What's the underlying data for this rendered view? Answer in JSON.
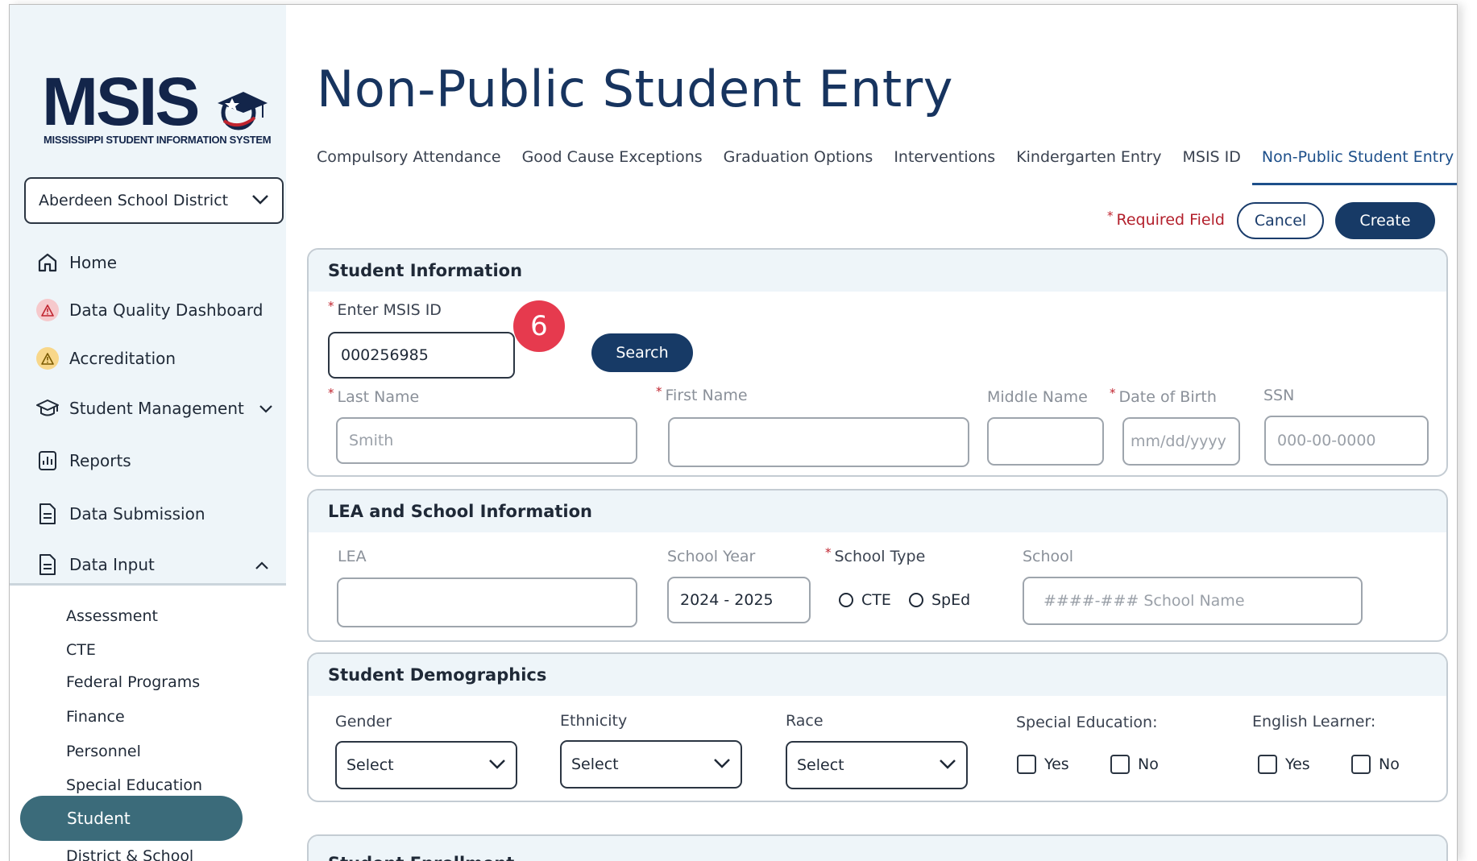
{
  "app": {
    "logo_text": "MSIS",
    "logo_subtitle": "MISSISSIPPI STUDENT INFORMATION SYSTEM",
    "page_title": "Non-Public Student Entry"
  },
  "sidebar": {
    "district": "Aberdeen School District",
    "nav": {
      "home": "Home",
      "data_quality": "Data Quality Dashboard",
      "accreditation": "Accreditation",
      "student_management": "Student Management",
      "reports": "Reports",
      "data_submission": "Data Submission",
      "data_input": "Data Input"
    },
    "submenu": [
      "Assessment",
      "CTE",
      "Federal Programs",
      "Finance",
      "Personnel",
      "Special Education",
      "Student",
      "District & School"
    ],
    "active_submenu": "Student"
  },
  "tabs": [
    "Compulsory Attendance",
    "Good Cause Exceptions",
    "Graduation Options",
    "Interventions",
    "Kindergarten Entry",
    "MSIS ID",
    "Non-Public Student Entry"
  ],
  "active_tab": "Non-Public Student Entry",
  "actions": {
    "required_note": "Required Field",
    "asterisk": "*",
    "cancel": "Cancel",
    "create": "Create"
  },
  "student_info": {
    "title": "Student Information",
    "msis_label": "Enter MSIS ID",
    "msis_value": "000256985",
    "step_badge": "6",
    "search": "Search",
    "last_name_label": "Last Name",
    "last_name_placeholder": "Smith",
    "first_name_label": "First Name",
    "middle_name_label": "Middle Name",
    "dob_label": "Date of Birth",
    "dob_placeholder": "mm/dd/yyyy",
    "ssn_label": "SSN",
    "ssn_placeholder": "000-00-0000"
  },
  "lea_info": {
    "title": "LEA and School Information",
    "lea_label": "LEA",
    "school_year_label": "School Year",
    "school_year_value": "2024 - 2025",
    "school_type_label": "School Type",
    "school_type_options": [
      "CTE",
      "SpEd"
    ],
    "school_label": "School",
    "school_placeholder": "####-### School Name"
  },
  "demographics": {
    "title": "Student Demographics",
    "gender_label": "Gender",
    "ethnicity_label": "Ethnicity",
    "race_label": "Race",
    "select_text": "Select",
    "special_ed_label": "Special Education:",
    "english_learner_label": "English Learner:",
    "yes": "Yes",
    "no": "No"
  },
  "enrollment": {
    "title": "Student Enrollment"
  },
  "colors": {
    "primary": "#173a66",
    "accent_red": "#c0242f",
    "badge": "#e63a4e",
    "sidebar_bg": "#eef5f9",
    "active_pill": "#3b6b7a"
  }
}
